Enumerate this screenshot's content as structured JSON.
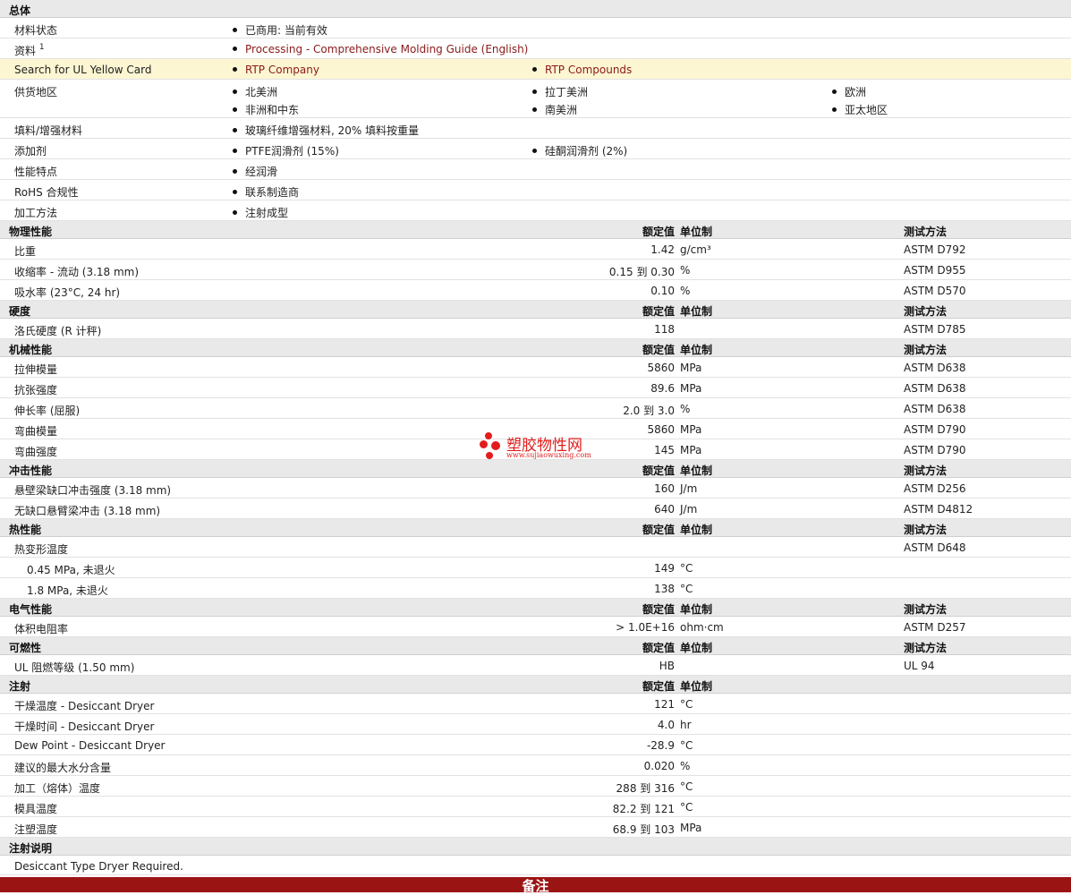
{
  "general": {
    "title": "总体",
    "material_status": {
      "label": "材料状态",
      "value": "已商用: 当前有效"
    },
    "docs": {
      "label": "资料",
      "sup": "1",
      "value": "Processing - Comprehensive Molding Guide (English)"
    },
    "ul": {
      "label": "Search for UL Yellow Card",
      "values": [
        "RTP Company",
        "RTP Compounds"
      ]
    },
    "regions": {
      "label": "供货地区",
      "values": [
        "北美洲",
        "拉丁美洲",
        "欧洲",
        "非洲和中东",
        "南美洲",
        "亚太地区"
      ]
    },
    "filler": {
      "label": "填料/增强材料",
      "value": "玻璃纤维增强材料, 20% 填料按重量"
    },
    "additives": {
      "label": "添加剂",
      "values": [
        "PTFE润滑剂 (15%)",
        "硅酮润滑剂 (2%)"
      ]
    },
    "features": {
      "label": "性能特点",
      "value": "经润滑"
    },
    "rohs": {
      "label": "RoHS 合规性",
      "value": "联系制造商"
    },
    "process": {
      "label": "加工方法",
      "value": "注射成型"
    }
  },
  "headers": {
    "value": "额定值",
    "unit": "单位制",
    "method": "测试方法"
  },
  "physical": {
    "title": "物理性能",
    "rows": [
      {
        "name": "比重",
        "value": "1.42",
        "unit": "g/cm³",
        "method": "ASTM D792"
      },
      {
        "name": "收缩率  - 流动  (3.18 mm)",
        "value": "0.15 到  0.30",
        "unit": "%",
        "method": "ASTM D955"
      },
      {
        "name": "吸水率 (23°C, 24 hr)",
        "value": "0.10",
        "unit": "%",
        "method": "ASTM D570"
      }
    ]
  },
  "hardness": {
    "title": "硬度",
    "rows": [
      {
        "name": "洛氏硬度  (R 计秤)",
        "value": "118",
        "unit": "",
        "method": "ASTM D785"
      }
    ]
  },
  "mechanical": {
    "title": "机械性能",
    "rows": [
      {
        "name": "拉伸模量",
        "value": "5860",
        "unit": "MPa",
        "method": "ASTM D638"
      },
      {
        "name": "抗张强度",
        "value": "89.6",
        "unit": "MPa",
        "method": "ASTM D638"
      },
      {
        "name": "伸长率  (屈服)",
        "value": "2.0 到  3.0",
        "unit": "%",
        "method": "ASTM D638"
      },
      {
        "name": "弯曲模量",
        "value": "5860",
        "unit": "MPa",
        "method": "ASTM D790"
      },
      {
        "name": "弯曲强度",
        "value": "145",
        "unit": "MPa",
        "method": "ASTM D790"
      }
    ]
  },
  "impact": {
    "title": "冲击性能",
    "rows": [
      {
        "name": "悬壁梁缺口冲击强度  (3.18 mm)",
        "value": "160",
        "unit": "J/m",
        "method": "ASTM D256"
      },
      {
        "name": "无缺口悬臂梁冲击  (3.18 mm)",
        "value": "640",
        "unit": "J/m",
        "method": "ASTM D4812"
      }
    ]
  },
  "thermal": {
    "title": "热性能",
    "hdt": {
      "name": "热变形温度",
      "method": "ASTM D648"
    },
    "rows": [
      {
        "name": "0.45 MPa, 未退火",
        "value": "149",
        "unit": "°C"
      },
      {
        "name": "1.8 MPa, 未退火",
        "value": "138",
        "unit": "°C"
      }
    ]
  },
  "electrical": {
    "title": "电气性能",
    "rows": [
      {
        "name": "体积电阻率",
        "value": "> 1.0E+16",
        "unit": "ohm·cm",
        "method": "ASTM D257"
      }
    ]
  },
  "flammability": {
    "title": "可燃性",
    "rows": [
      {
        "name": "UL 阻燃等级  (1.50 mm)",
        "value": "HB",
        "unit": "",
        "method": "UL 94"
      }
    ]
  },
  "injection": {
    "title": "注射",
    "rows": [
      {
        "name": "干燥温度  - Desiccant Dryer",
        "value": "121",
        "unit": "°C"
      },
      {
        "name": "干燥时间  - Desiccant Dryer",
        "value": "4.0",
        "unit": "hr"
      },
      {
        "name": "Dew Point - Desiccant Dryer",
        "value": "-28.9",
        "unit": "°C"
      },
      {
        "name": "建议的最大水分含量",
        "value": "0.020",
        "unit": "%"
      },
      {
        "name": "加工（熔体）温度",
        "value": "288 到  316",
        "unit": "°C"
      },
      {
        "name": "模具温度",
        "value": "82.2 到  121",
        "unit": "°C"
      },
      {
        "name": "注塑温度",
        "value": "68.9 到  103",
        "unit": "MPa"
      }
    ]
  },
  "injection_notes": {
    "title": "注射说明",
    "text": "Desiccant Type Dryer Required."
  },
  "footer": {
    "label": "备注"
  },
  "watermark": {
    "title": "塑胶物性网",
    "url": "www.sujiaowuxing.com",
    "color": "#e21d1d"
  }
}
